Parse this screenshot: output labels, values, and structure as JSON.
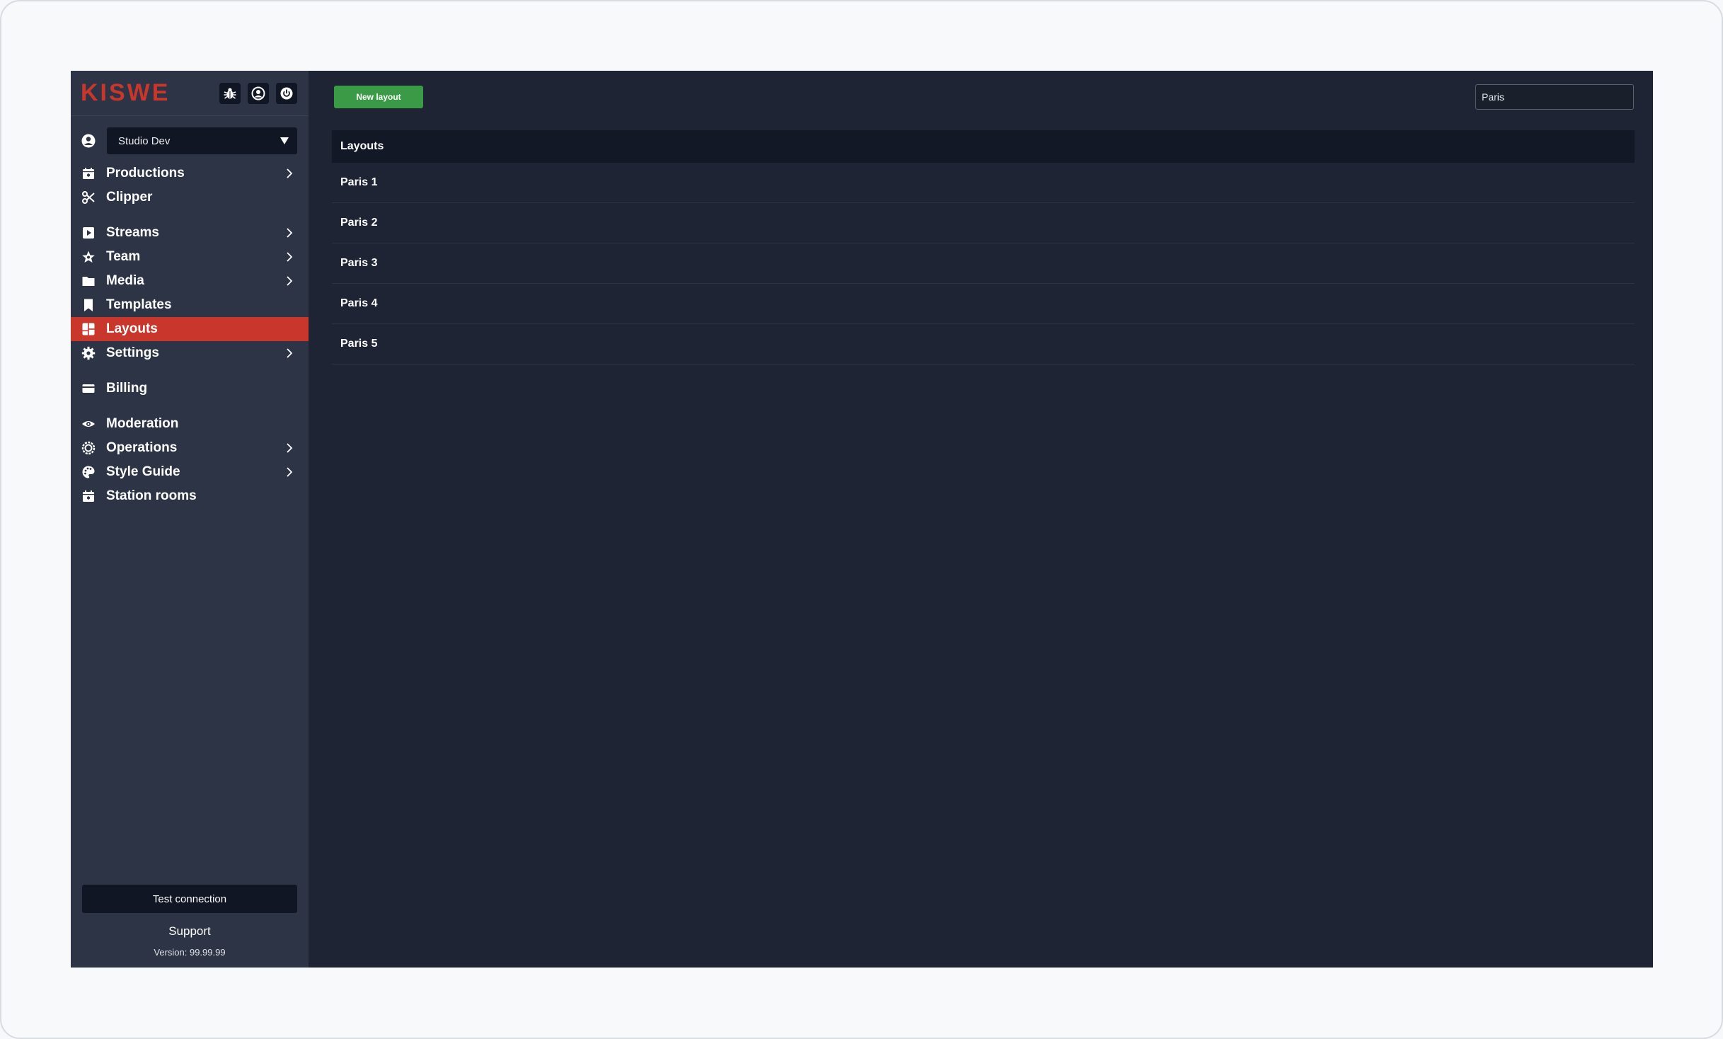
{
  "sidebar": {
    "logo": "KISWE",
    "header_icons": [
      "bug-icon",
      "user-circle-icon",
      "power-icon"
    ],
    "org_select": {
      "value": "Studio Dev"
    },
    "items": [
      {
        "label": "Productions",
        "icon": "calendar-icon",
        "chevron": true
      },
      {
        "label": "Clipper",
        "icon": "scissors-icon",
        "chevron": false
      },
      {
        "label": "Streams",
        "icon": "play-icon",
        "chevron": true
      },
      {
        "label": "Team",
        "icon": "star-icon",
        "chevron": true
      },
      {
        "label": "Media",
        "icon": "folder-icon",
        "chevron": true
      },
      {
        "label": "Templates",
        "icon": "bookmark-icon",
        "chevron": false
      },
      {
        "label": "Layouts",
        "icon": "layout-icon",
        "chevron": false,
        "active": true
      },
      {
        "label": "Settings",
        "icon": "gear-icon",
        "chevron": true
      },
      {
        "label": "Billing",
        "icon": "credit-card-icon",
        "chevron": false
      },
      {
        "label": "Moderation",
        "icon": "eye-icon",
        "chevron": false
      },
      {
        "label": "Operations",
        "icon": "cog-ring-icon",
        "chevron": true
      },
      {
        "label": "Style Guide",
        "icon": "palette-icon",
        "chevron": true
      },
      {
        "label": "Station rooms",
        "icon": "calendar-icon",
        "chevron": false
      }
    ],
    "test_connection_label": "Test connection",
    "support_label": "Support",
    "version": "Version: 99.99.99"
  },
  "main": {
    "new_layout_label": "New layout",
    "search": {
      "value": "Paris",
      "placeholder": ""
    },
    "table": {
      "header": "Layouts",
      "rows": [
        "Paris 1",
        "Paris 2",
        "Paris 3",
        "Paris 4",
        "Paris 5"
      ]
    }
  },
  "colors": {
    "accent": "#c9362b",
    "primary_button": "#3a9a45",
    "sidebar_bg": "#2d3445",
    "main_bg": "#1e2433"
  }
}
